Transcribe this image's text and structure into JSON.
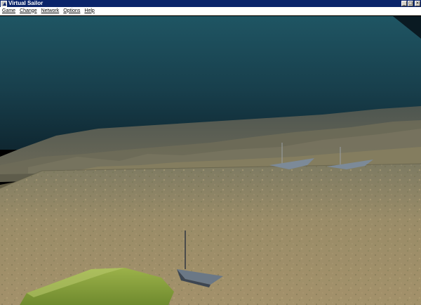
{
  "window": {
    "title": "Virtual Sailor",
    "minimize_symbol": "_",
    "maximize_symbol": "□",
    "close_symbol": "×"
  },
  "menu": {
    "items": [
      {
        "label": "Game"
      },
      {
        "label": "Change"
      },
      {
        "label": "Network"
      },
      {
        "label": "Options"
      },
      {
        "label": "Help"
      }
    ]
  },
  "scene": {
    "sky_color": "#1a4654",
    "sea_floor_color": "#9a8a64",
    "boat_color": "#6b7886",
    "island_color": "#8aa040"
  }
}
